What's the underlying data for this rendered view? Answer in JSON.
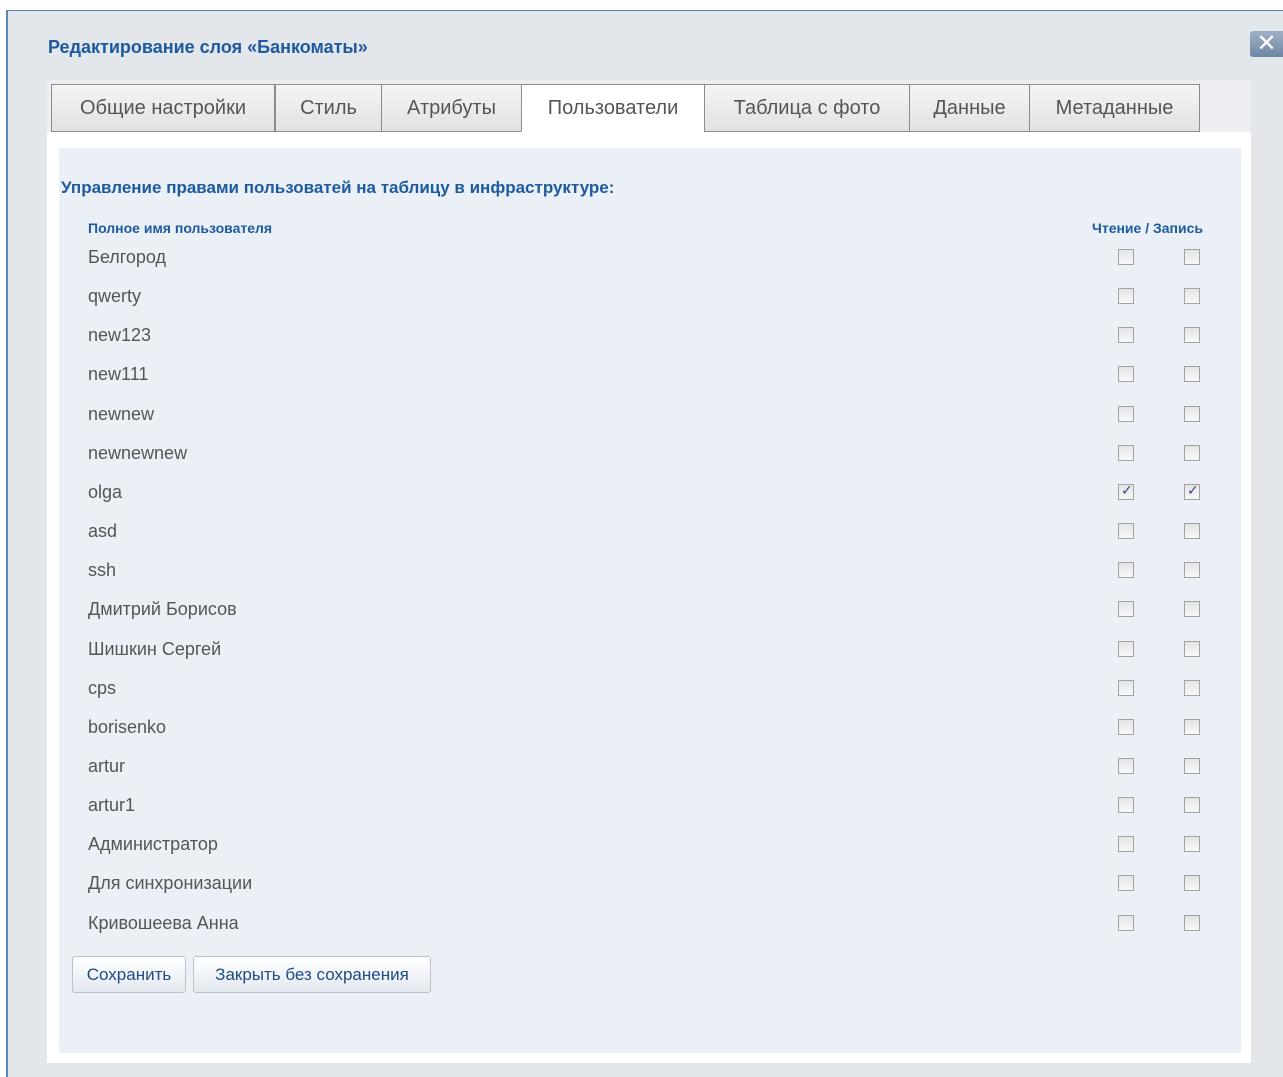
{
  "dialog": {
    "title": "Редактирование слоя «Банкоматы»",
    "close_label": "✕"
  },
  "tabs": [
    {
      "label": "Общие настройки",
      "active": false
    },
    {
      "label": "Стиль",
      "active": false
    },
    {
      "label": "Атрибуты",
      "active": false
    },
    {
      "label": "Пользователи",
      "active": true
    },
    {
      "label": "Таблица с фото",
      "active": false
    },
    {
      "label": "Данные",
      "active": false
    },
    {
      "label": "Метаданные",
      "active": false
    }
  ],
  "permissions": {
    "title": "Управление правами пользоватей на таблицу в инфраструктуре:",
    "header_name": "Полное имя пользователя",
    "header_rw": "Чтение / Запись",
    "users": [
      {
        "name": "Белгород",
        "read": false,
        "write": false
      },
      {
        "name": "qwerty",
        "read": false,
        "write": false
      },
      {
        "name": "new123",
        "read": false,
        "write": false
      },
      {
        "name": "new111",
        "read": false,
        "write": false
      },
      {
        "name": "newnew",
        "read": false,
        "write": false
      },
      {
        "name": "newnewnew",
        "read": false,
        "write": false
      },
      {
        "name": "olga",
        "read": true,
        "write": true
      },
      {
        "name": "asd",
        "read": false,
        "write": false
      },
      {
        "name": "ssh",
        "read": false,
        "write": false
      },
      {
        "name": "Дмитрий Борисов",
        "read": false,
        "write": false
      },
      {
        "name": "Шишкин Сергей",
        "read": false,
        "write": false
      },
      {
        "name": "cps",
        "read": false,
        "write": false
      },
      {
        "name": "borisenko",
        "read": false,
        "write": false
      },
      {
        "name": "artur",
        "read": false,
        "write": false
      },
      {
        "name": "artur1",
        "read": false,
        "write": false
      },
      {
        "name": "Администратор",
        "read": false,
        "write": false
      },
      {
        "name": "Для синхронизации",
        "read": false,
        "write": false
      },
      {
        "name": "Кривошеева Анна",
        "read": false,
        "write": false
      }
    ]
  },
  "buttons": {
    "save_label": "Сохранить",
    "close_label": "Закрыть без сохранения"
  }
}
